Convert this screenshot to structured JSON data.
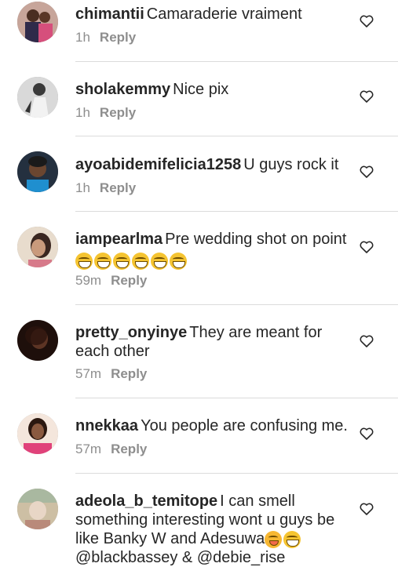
{
  "comments": [
    {
      "username": "chimantii",
      "text": "Camaraderie vraiment",
      "time": "1h",
      "reply": "Reply",
      "avatar_color": "#8a6a5c"
    },
    {
      "username": "sholakemmy",
      "text": "Nice pix",
      "time": "1h",
      "reply": "Reply",
      "avatar_color": "#b9b9b9"
    },
    {
      "username": "ayoabidemifelicia1258",
      "text": "U guys rock it",
      "time": "1h",
      "reply": "Reply",
      "avatar_color": "#2f3a4a"
    },
    {
      "username": "iampearlma",
      "text": "Pre wedding shot on point",
      "emojis": [
        "grin-icon",
        "grin-icon",
        "grin-icon",
        "grin-icon",
        "grin-icon",
        "grin-icon"
      ],
      "time": "59m",
      "reply": "Reply",
      "avatar_color": "#d9c9b8"
    },
    {
      "username": "pretty_onyinye",
      "text": "They are meant for each other",
      "time": "57m",
      "reply": "Reply",
      "avatar_color": "#3a1f17"
    },
    {
      "username": "nnekkaa",
      "text": "You people are confusing me.",
      "time": "57m",
      "reply": "Reply",
      "avatar_color": "#e0427a"
    },
    {
      "username": "adeola_b_temitope",
      "text": "I can smell something interesting wont u guys be like Banky W and Adesuwa",
      "mentions": "@blackbassey & @debie_rise",
      "emojis": [
        "blush-icon",
        "grin-icon"
      ],
      "time": "",
      "reply": "",
      "avatar_color": "#c9b79a"
    }
  ],
  "colors": {
    "text": "#262626",
    "meta": "#8e8e8e",
    "divider": "#dbdbdb",
    "mention": "#003569"
  }
}
